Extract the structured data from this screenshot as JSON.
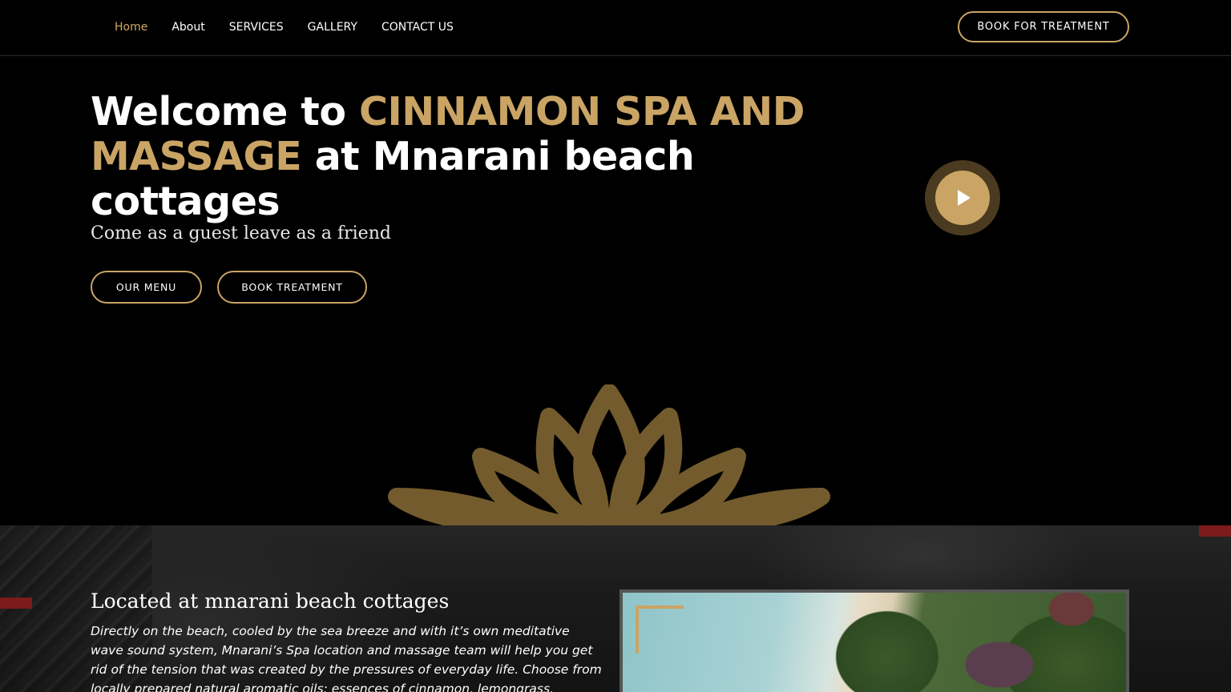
{
  "nav": {
    "links": [
      {
        "label": "Home",
        "active": true
      },
      {
        "label": "About"
      },
      {
        "label": "SERVICES"
      },
      {
        "label": "GALLERY"
      },
      {
        "label": "CONTACT US"
      }
    ],
    "cta_label": "BOOK FOR TREATMENT"
  },
  "hero": {
    "title_prefix": "Welcome to ",
    "title_highlight": "CINNAMON SPA AND MASSAGE",
    "title_suffix": " at Mnarani beach cottages",
    "subtitle": "Come as a guest leave as a friend",
    "buttons": {
      "menu_label": "OUR MENU",
      "book_label": "BOOK TREATMENT"
    },
    "play_icon": "play-icon",
    "decoration_icon": "lotus-icon"
  },
  "about": {
    "title": "Located at mnarani beach cottages",
    "text": "Directly on the beach, cooled by the sea breeze and with it’s own meditative wave sound system, Mnarani’s Spa location and massage team will help you get rid of the tension that was created by the pressures of everyday life. Choose from locally prepared natural aromatic oils: essences of cinnamon, lemongrass, jasmine or clove oil to help you relax"
  },
  "colors": {
    "accent": "#c9a464",
    "background": "#000000",
    "text": "#ffffff"
  }
}
